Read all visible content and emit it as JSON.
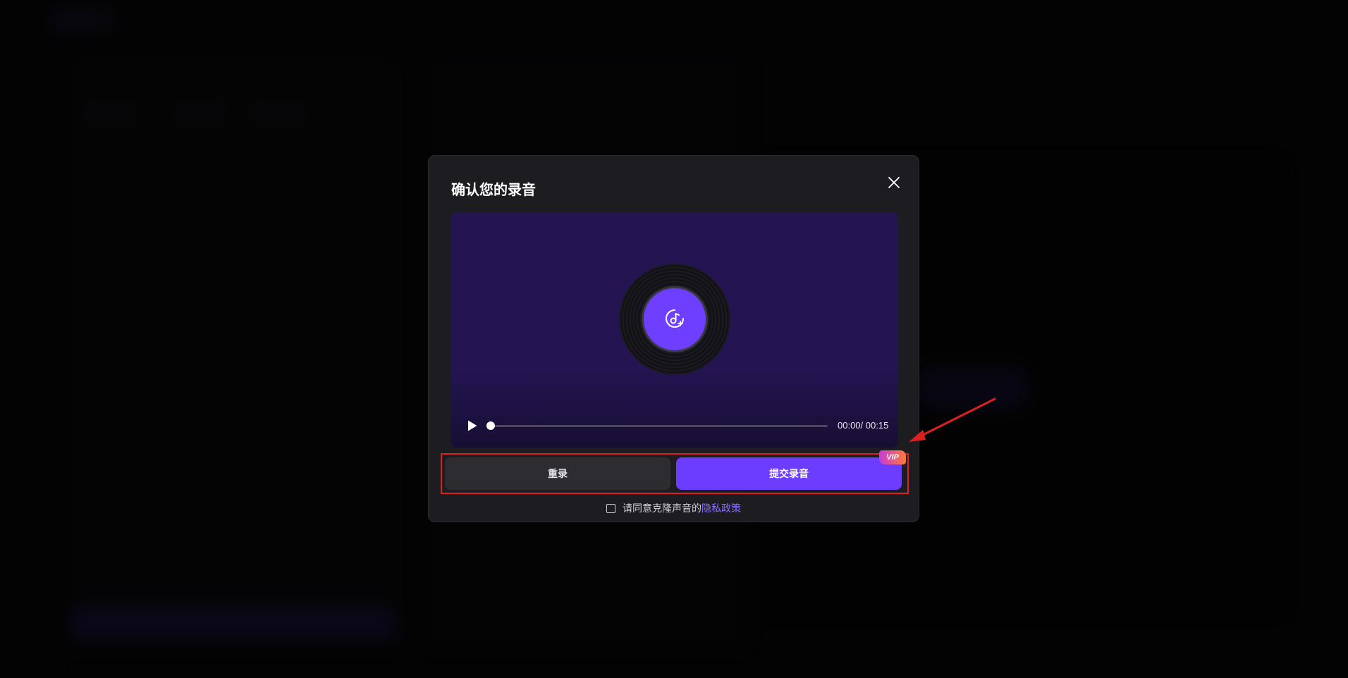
{
  "dialog": {
    "title": "确认您的录音",
    "close_icon": "close-icon"
  },
  "player": {
    "disc_icon": "music-note-icon",
    "play_icon": "play-icon",
    "time_current": "00:00",
    "time_separator": "/",
    "time_total": " 00:15",
    "progress": 0.0
  },
  "actions": {
    "rerecord_label": "重录",
    "submit_label": "提交录音",
    "vip_badge": "VIP"
  },
  "agreement": {
    "text": "请同意克隆声音的",
    "link_text": "隐私政策",
    "checked": false
  },
  "colors": {
    "accent": "#6c3dff",
    "highlight_box": "#e02020",
    "link": "#8a6bff"
  }
}
